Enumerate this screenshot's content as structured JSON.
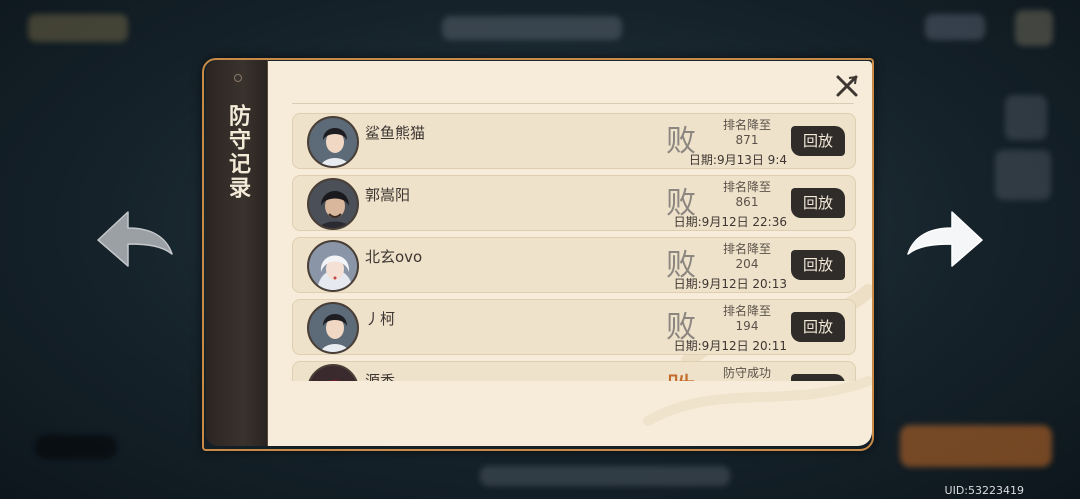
{
  "dialog": {
    "title": "防守记录",
    "rows": [
      {
        "name": "鲨鱼熊猫",
        "result": "败",
        "rank_label": "排名降至",
        "rank": "871",
        "date": "日期:9月13日 9:4",
        "replay": "回放"
      },
      {
        "name": "郭嵩阳",
        "result": "败",
        "rank_label": "排名降至",
        "rank": "861",
        "date": "日期:9月12日 22:36",
        "replay": "回放"
      },
      {
        "name": "北玄ovo",
        "result": "败",
        "rank_label": "排名降至",
        "rank": "204",
        "date": "日期:9月12日 20:13",
        "replay": "回放"
      },
      {
        "name": "丿柯",
        "result": "败",
        "rank_label": "排名降至",
        "rank": "194",
        "date": "日期:9月12日 20:11",
        "replay": "回放"
      },
      {
        "name": "源香",
        "result": "胜",
        "rank_label": "防守成功",
        "rank": "",
        "date": "",
        "replay": ""
      }
    ]
  },
  "footer": {
    "uid": "UID:53223419"
  },
  "icons": {
    "close": "close-icon",
    "prev": "arrow-left-icon",
    "next": "arrow-right-icon"
  },
  "colors": {
    "panel": "#f6ecd9",
    "accent": "#c88a45",
    "lose": "#8c8680",
    "win": "#c26b2a"
  }
}
